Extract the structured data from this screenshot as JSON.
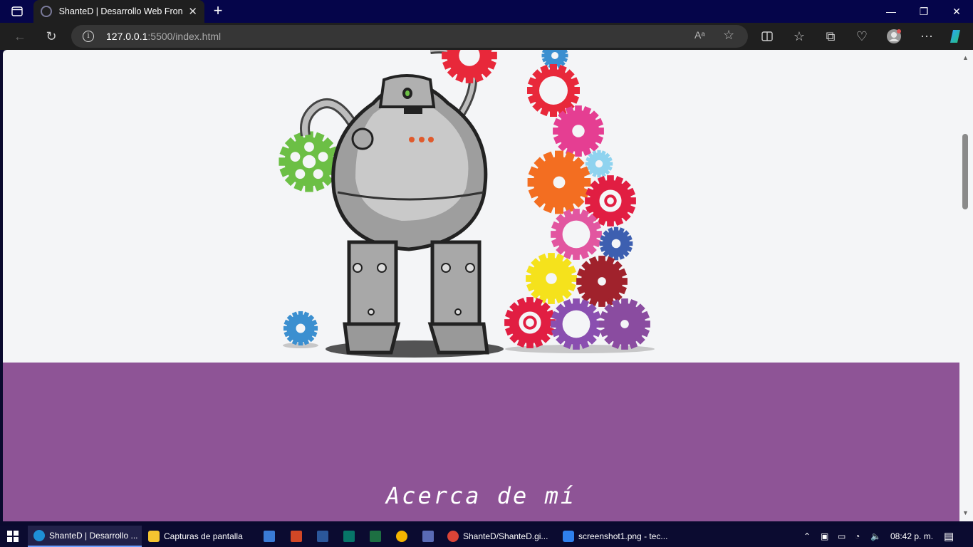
{
  "browser": {
    "tab_title": "ShanteD | Desarrollo Web Front-E",
    "tab_close": "✕",
    "new_tab": "+",
    "url_host": "127.0.0.1",
    "url_rest": ":5500/index.html",
    "read_aloud": "Aᵃ",
    "window_minimize": "—",
    "window_restore": "❐",
    "window_close": "✕"
  },
  "page": {
    "section_heading": "Acerca de mí",
    "section_bg_color": "#8e5496"
  },
  "taskbar": {
    "items": [
      {
        "label": "ShanteD | Desarrollo ...",
        "color": "#1e90d6"
      },
      {
        "label": "Capturas de pantalla",
        "color": "#f4c430"
      },
      {
        "label": "ShanteD/ShanteD.gi...",
        "color": "#db4437"
      },
      {
        "label": "screenshot1.png - tec...",
        "color": "#2f80ed"
      }
    ],
    "time": "08:42 p. m."
  }
}
